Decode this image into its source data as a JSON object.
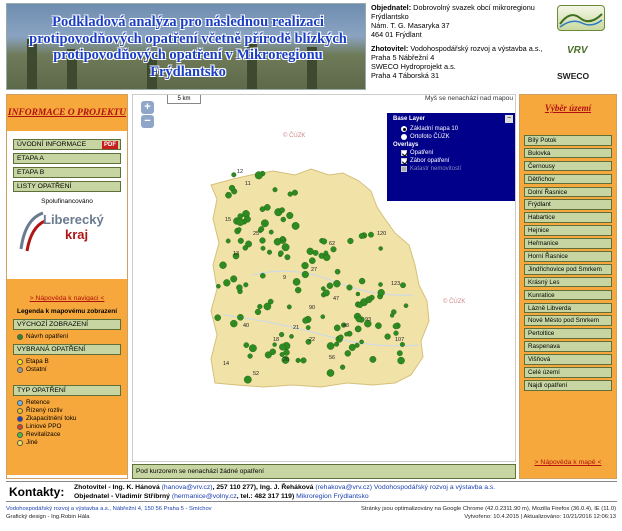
{
  "header": {
    "title": "Podkladová analýza pro následnou realizaci protipovodňových opatření včetně přírodě blízkých protipovodňových opatření v Mikroregionu Frýdlantsko",
    "objednatel_label": "Objednatel:",
    "objednatel_text": "Dobrovolný svazek obcí mikroregionu Frýdlantsko",
    "objednatel_addr1": "Nám. T. G. Masaryka 37",
    "objednatel_addr2": "464 01 Frýdlant",
    "zhotovitel_label": "Zhotovitel:",
    "zhotovitel_text": "Vodohospodářský rozvoj a výstavba a.s., Praha 5 Nábřežní 4",
    "zhotovitel_text2": "SWECO Hydroprojekt a.s.",
    "zhotovitel_text3": "Praha 4 Táborská 31",
    "logo_vrv": "VRV",
    "logo_sweco": "SWECO"
  },
  "left_panel": {
    "title": "INFORMACE O PROJEKTU",
    "buttons": [
      "ÚVODNÍ INFORMACE",
      "ETAPA A",
      "ETAPA B",
      "LISTY OPATŘENÍ"
    ],
    "pdf_badge": "PDF",
    "sponsor_label": "Spolufinancováno",
    "sponsor_logo_line1": "Liberecký",
    "sponsor_logo_line2": "kraj",
    "help_link": "> Nápověda k navigaci <",
    "legend_title": "Legenda k mapovému zobrazení",
    "legend_sections": {
      "vychozi": "VÝCHOZÍ ZOBRAZENÍ",
      "vychozi_item": "Návrh opatření",
      "vybrana": "VYBRANÁ OPATŘENÍ",
      "vybrana_items": [
        "Etapa B",
        "Ostatní"
      ],
      "typ": "TYP OPATŘENÍ",
      "typ_items": [
        "Retence",
        "Řízený rozliv",
        "Zkapacitnění toku",
        "Liniové PPO",
        "Revitalizace",
        "Jiné"
      ]
    },
    "colors": {
      "navrh": "#2e8b20",
      "etapa_b": "#f5e21a",
      "ostatni": "#9a9a9a",
      "typ": [
        "#6fb7e8",
        "#f0c020",
        "#2040c0",
        "#e04020",
        "#40c040",
        "#f0e060"
      ]
    }
  },
  "map": {
    "scale_label": "5 km",
    "hover_text": "Myš se nenachází nad mapou",
    "watermark": "© ČÚZK",
    "zoom_in": "+",
    "zoom_out": "−",
    "layers": {
      "title": "Base Layer",
      "base": [
        "Základní mapa 10",
        "Ortofoto ČÚZK"
      ],
      "overlays_title": "Overlays",
      "overlays": [
        "Opatření",
        "Zábor opatření",
        "Katastr nemovitostí"
      ]
    },
    "point_labels": [
      "12",
      "11",
      "15",
      "25",
      "13",
      "120",
      "62",
      "27",
      "9",
      "123",
      "90",
      "47",
      "40",
      "18",
      "21",
      "22",
      "48",
      "93",
      "56",
      "14",
      "52",
      "26",
      "107"
    ]
  },
  "status_bar": "Pod kurzorem se nenachází žádné opatření",
  "right_panel": {
    "title": "Výběr území",
    "items": [
      "Bílý Potok",
      "Bulovka",
      "Černousy",
      "Dětřichov",
      "Dolní Řasnice",
      "Frýdlant",
      "Habartice",
      "Hejnice",
      "Heřmanice",
      "Horní Řasnice",
      "Jindřichovice pod Smrkem",
      "Krásný Les",
      "Kunratice",
      "Lázně Libverda",
      "Nové Město pod Smrkem",
      "Pertoltice",
      "Raspenava",
      "Višňová",
      "Celé území",
      "Najdi opatření"
    ],
    "help_link": "> Nápověda k mapě <"
  },
  "contacts": {
    "label": "Kontakty:",
    "line1_a": "Zhotovitel - Ing. K. Hánová",
    "line1_email1": "(hanova@vrv.cz)",
    "line1_b": ", 257 110 277),  Ing. J. Řeháková",
    "line1_email2": "(rehakova@vrv.cz)",
    "line1_c": "Vodohospodářský rozvoj a výstavba a.s.",
    "line2_a": "Objednatel - Vladimír Stříbrný",
    "line2_email": "(hermanice@volny.cz",
    "line2_b": ", tel.: 482 317 119)",
    "line2_c": "Mikroregion Frýdlantsko"
  },
  "footer": {
    "left1": "Vodohospodářský rozvoj a výstavba a.s., Nábřežní 4, 150 56 Praha 5 - Smíchov",
    "left2": "Grafický design - Ing.Robin Hála",
    "right1": "Stránky jsou optimalizovány na Google Chrome (42.0.2311.90 m), Mozilla Firefox (36.0.4), IE (11.0)",
    "right2": "Vytvořeno: 10.4.2015  |  Aktualizováno: 10/21/2016 12:06:13"
  }
}
